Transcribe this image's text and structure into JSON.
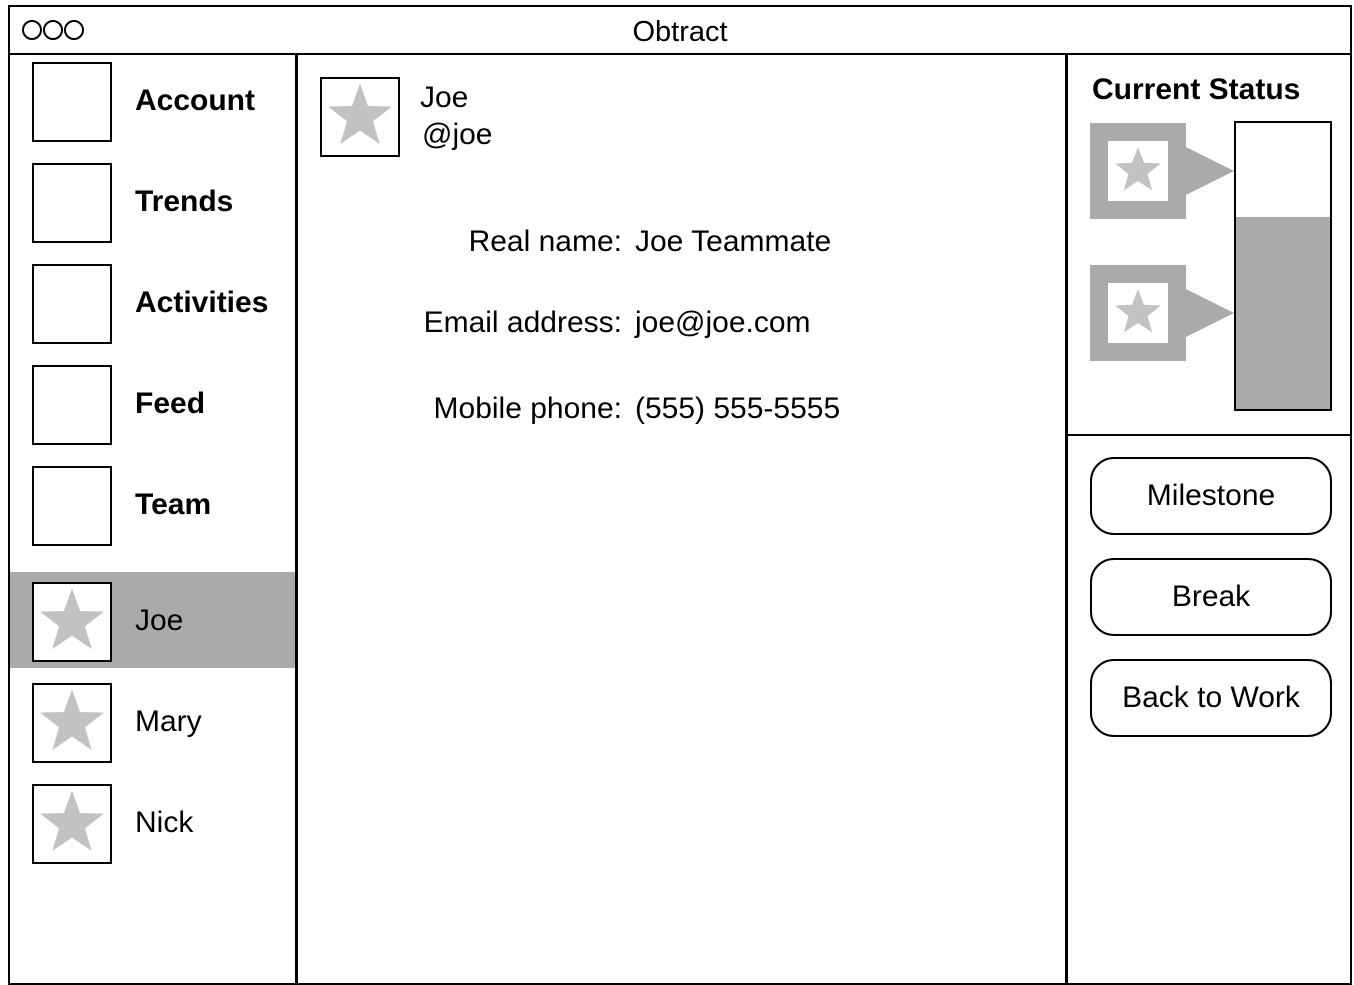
{
  "window": {
    "title": "Obtract",
    "controls": [
      "close",
      "minimize",
      "zoom"
    ]
  },
  "sidebar": {
    "items": [
      {
        "label": "Account",
        "icon": "blank-box-icon",
        "bold": true
      },
      {
        "label": "Trends",
        "icon": "blank-box-icon",
        "bold": true
      },
      {
        "label": "Activities",
        "icon": "blank-box-icon",
        "bold": true
      },
      {
        "label": "Feed",
        "icon": "blank-box-icon",
        "bold": true
      },
      {
        "label": "Team",
        "icon": "blank-box-icon",
        "bold": true
      },
      {
        "label": "Joe",
        "icon": "star-avatar-icon",
        "selected": true
      },
      {
        "label": "Mary",
        "icon": "star-avatar-icon"
      },
      {
        "label": "Nick",
        "icon": "star-avatar-icon"
      }
    ]
  },
  "profile": {
    "name": "Joe",
    "handle": "@joe",
    "fields": [
      {
        "label": "Real name:",
        "value": "Joe Teammate"
      },
      {
        "label": "Email address:",
        "value": "joe@joe.com"
      },
      {
        "label": "Mobile phone:",
        "value": "(555) 555-5555"
      }
    ]
  },
  "status": {
    "title": "Current Status",
    "level_fraction": 0.67
  },
  "actions": {
    "milestone": "Milestone",
    "break": "Break",
    "back_to_work": "Back to Work"
  },
  "colors": {
    "selection": "#aaaaaa",
    "star": "#c2c2c2",
    "border": "#000000",
    "background": "#ffffff"
  }
}
